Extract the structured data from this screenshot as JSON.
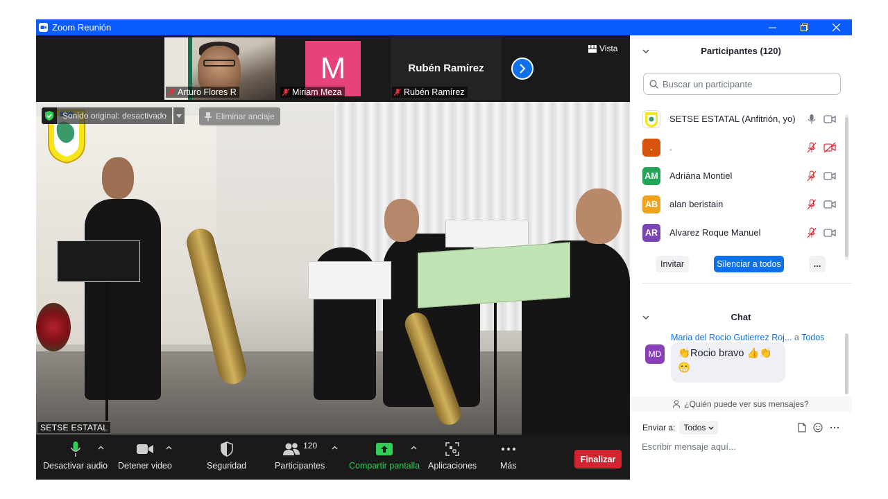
{
  "window": {
    "title": "Zoom Reunión",
    "controls": [
      "minimize",
      "restore",
      "close"
    ]
  },
  "strip": {
    "tiles": [
      {
        "name": "Arturo Flores R",
        "type": "video",
        "muted": true
      },
      {
        "name": "Miriam Meza",
        "type": "avatar",
        "initial": "M",
        "color": "#e8427a",
        "muted": true
      },
      {
        "name": "Rubén Ramírez",
        "type": "name-only",
        "display": "Rubén Ramírez",
        "muted": true
      }
    ],
    "view_label": "Vista"
  },
  "main_video": {
    "sonido_label": "Sonido original: desactivado",
    "eliminar_label": "Eliminar anclaje",
    "speaker_label": "SETSE ESTATAL"
  },
  "toolbar": {
    "audio": "Desactivar audio",
    "video": "Detener video",
    "security": "Seguridad",
    "participants": "Participantes",
    "participants_count": "120",
    "share": "Compartir pantalla",
    "apps": "Aplicaciones",
    "more": "Más",
    "end": "Finalizar"
  },
  "participants_panel": {
    "title": "Participantes (120)",
    "search_placeholder": "Buscar un participante",
    "list": [
      {
        "initials": "",
        "name": "SETSE ESTATAL (Anfitrión, yo)",
        "color": "#ffffff",
        "mic": "on",
        "cam": "on"
      },
      {
        "initials": ".",
        "name": ".",
        "color": "#d9530f",
        "mic": "off",
        "cam": "off"
      },
      {
        "initials": "AM",
        "name": "Adriána Montiel",
        "color": "#22a557",
        "mic": "off",
        "cam": "on"
      },
      {
        "initials": "AB",
        "name": "alan beristain",
        "color": "#f0a21e",
        "mic": "off",
        "cam": "on"
      },
      {
        "initials": "AR",
        "name": "Alvarez Roque Manuel",
        "color": "#7b45b5",
        "mic": "off",
        "cam": "on"
      }
    ],
    "invite": "Invitar",
    "mute_all": "Silenciar a todos",
    "more": "..."
  },
  "chat": {
    "title": "Chat",
    "messages": [
      {
        "sender": "Maria del Rocio Gutierrez Roj...",
        "to_prefix": "a",
        "to": "Todos",
        "initials": "MD",
        "line1": "👏Rocio bravo 👍👏",
        "line2": "😁"
      }
    ],
    "who_sees": "¿Quién puede ver sus mensajes?",
    "send_to_label": "Enviar a:",
    "send_to_value": "Todos",
    "input_placeholder": "Escribir mensaje aquí..."
  },
  "colors": {
    "titlebar": "#0b5cff",
    "accent": "#0e71eb",
    "end": "#d1242f",
    "share_green": "#2fce56",
    "muted_red": "#e0323c"
  }
}
